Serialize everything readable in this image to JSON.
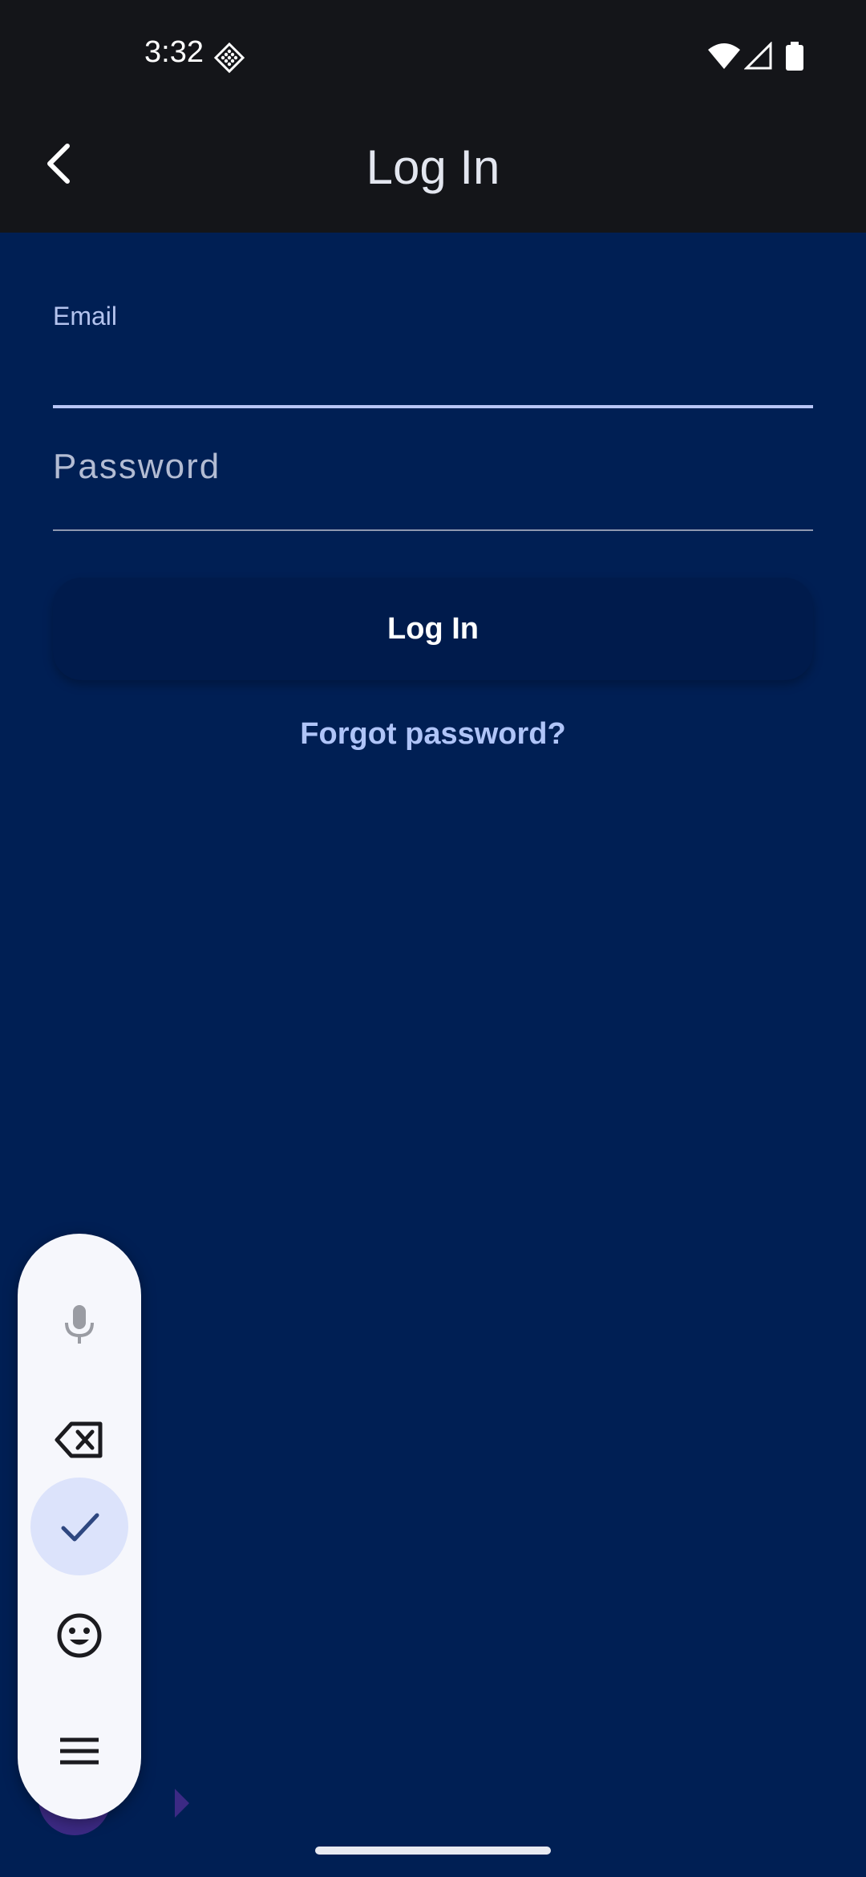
{
  "status_bar": {
    "time": "3:32",
    "icons": [
      "notification-icon",
      "wifi-icon",
      "signal-icon",
      "battery-icon"
    ]
  },
  "app_bar": {
    "title": "Log In",
    "back_icon": "chevron-left-icon"
  },
  "form": {
    "email": {
      "label": "Email",
      "value": ""
    },
    "password": {
      "placeholder": "Password",
      "value": ""
    },
    "login_button_label": "Log In",
    "forgot_password_label": "Forgot password?"
  },
  "floating_toolbar": {
    "items": [
      "mic-icon",
      "backspace-icon",
      "check-icon",
      "emoji-icon",
      "menu-icon"
    ]
  },
  "colors": {
    "background": "#001F54",
    "app_bar": "#141519",
    "accent": "#B8C5F5",
    "link": "#AFC4F8",
    "toolbar_bg": "#F6F7FC",
    "done_bg": "#DCE3FB"
  }
}
